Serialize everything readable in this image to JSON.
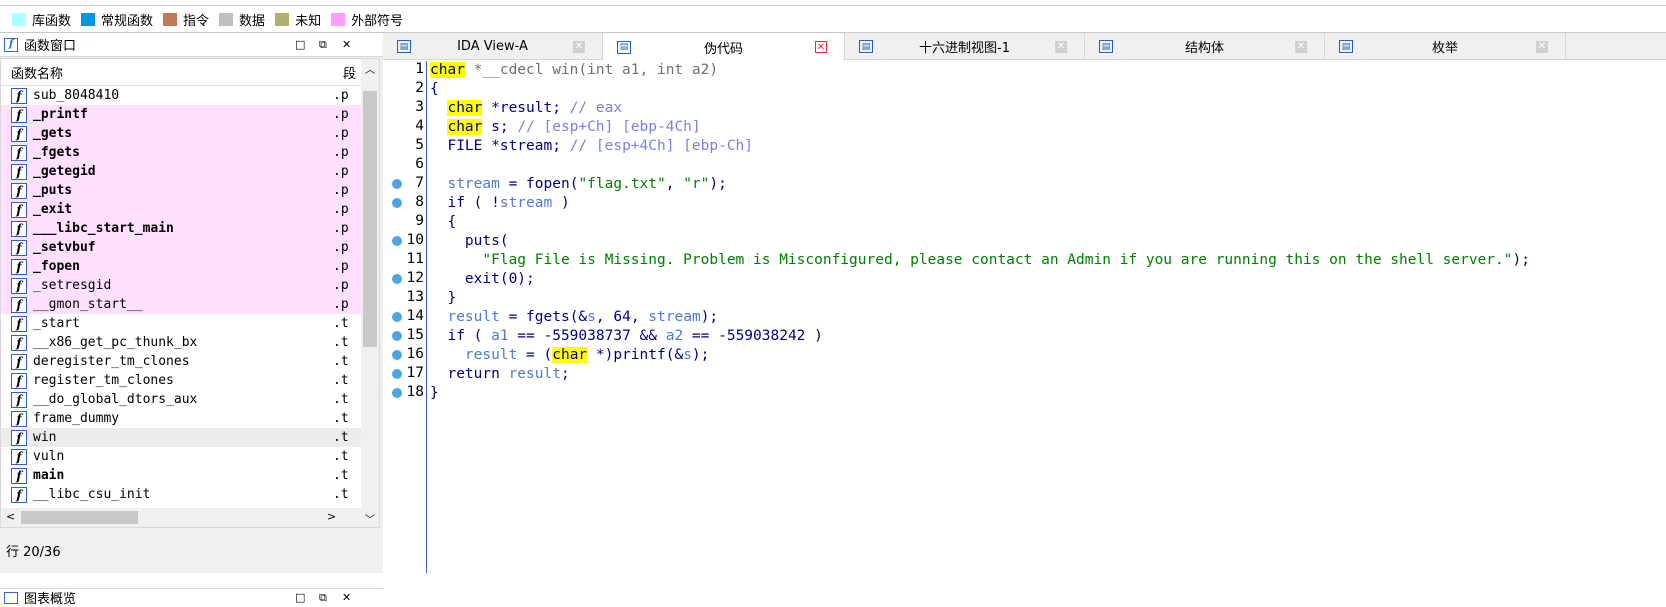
{
  "legend": [
    {
      "label": "库函数",
      "color": "#aaffff"
    },
    {
      "label": "常规函数",
      "color": "#0096e0"
    },
    {
      "label": "指令",
      "color": "#c07a5a"
    },
    {
      "label": "数据",
      "color": "#c0c0c0"
    },
    {
      "label": "未知",
      "color": "#b0b070"
    },
    {
      "label": "外部符号",
      "color": "#ff9cff"
    }
  ],
  "functions_window": {
    "title": "函数窗口",
    "col_name": "函数名称",
    "col_segment": "段",
    "rows": [
      {
        "name": "sub_8048410",
        "seg": ".p",
        "style": "normal"
      },
      {
        "name": "_printf",
        "seg": ".p",
        "style": "ext-bold"
      },
      {
        "name": "_gets",
        "seg": ".p",
        "style": "ext-bold"
      },
      {
        "name": "_fgets",
        "seg": ".p",
        "style": "ext-bold"
      },
      {
        "name": "_getegid",
        "seg": ".p",
        "style": "ext-bold"
      },
      {
        "name": "_puts",
        "seg": ".p",
        "style": "ext-bold"
      },
      {
        "name": "_exit",
        "seg": ".p",
        "style": "ext-bold"
      },
      {
        "name": "___libc_start_main",
        "seg": ".p",
        "style": "ext-bold"
      },
      {
        "name": "_setvbuf",
        "seg": ".p",
        "style": "ext-bold"
      },
      {
        "name": "_fopen",
        "seg": ".p",
        "style": "ext-bold"
      },
      {
        "name": "_setresgid",
        "seg": ".p",
        "style": "ext"
      },
      {
        "name": "__gmon_start__",
        "seg": ".p",
        "style": "ext"
      },
      {
        "name": "_start",
        "seg": ".t",
        "style": "normal"
      },
      {
        "name": "__x86_get_pc_thunk_bx",
        "seg": ".t",
        "style": "normal"
      },
      {
        "name": "deregister_tm_clones",
        "seg": ".t",
        "style": "normal"
      },
      {
        "name": "register_tm_clones",
        "seg": ".t",
        "style": "normal"
      },
      {
        "name": "__do_global_dtors_aux",
        "seg": ".t",
        "style": "normal"
      },
      {
        "name": "frame_dummy",
        "seg": ".t",
        "style": "normal"
      },
      {
        "name": "win",
        "seg": ".t",
        "style": "selected"
      },
      {
        "name": "vuln",
        "seg": ".t",
        "style": "normal"
      },
      {
        "name": "main",
        "seg": ".t",
        "style": "bold"
      },
      {
        "name": "__libc_csu_init",
        "seg": ".t",
        "style": "normal"
      }
    ],
    "status": "行 20/36"
  },
  "overview_title": "图表概览",
  "tabs": [
    {
      "label": "IDA View-A",
      "icon": "ida-view-icon",
      "active": false
    },
    {
      "label": "伪代码",
      "icon": "pseudocode-icon",
      "active": true
    },
    {
      "label": "十六进制视图-1",
      "icon": "hex-view-icon",
      "active": false
    },
    {
      "label": "结构体",
      "icon": "structures-icon",
      "active": false
    },
    {
      "label": "枚举",
      "icon": "enums-icon",
      "active": false
    }
  ],
  "code": {
    "line_numbers": [
      "1",
      "2",
      "3",
      "4",
      "5",
      "6",
      "7",
      "8",
      "9",
      "10",
      "11",
      "12",
      "13",
      "14",
      "15",
      "16",
      "17",
      "18"
    ],
    "breakpoint_lines": [
      7,
      8,
      10,
      12,
      14,
      15,
      16,
      17,
      18
    ],
    "lines": [
      [
        [
          "kw",
          "char"
        ],
        [
          "gray",
          " *__cdecl win(int a1, int a2)"
        ]
      ],
      [
        [
          "blue",
          "{"
        ]
      ],
      [
        [
          "blue",
          "  "
        ],
        [
          "kw",
          "char"
        ],
        [
          "blue",
          " *result; "
        ],
        [
          "cm",
          "// eax"
        ]
      ],
      [
        [
          "blue",
          "  "
        ],
        [
          "kw",
          "char"
        ],
        [
          "blue",
          " s; "
        ],
        [
          "cm",
          "// [esp+Ch] [ebp-4Ch]"
        ]
      ],
      [
        [
          "blue",
          "  FILE *stream; "
        ],
        [
          "cm",
          "// [esp+4Ch] [ebp-Ch]"
        ]
      ],
      [
        [
          "blue",
          ""
        ]
      ],
      [
        [
          "blue",
          "  "
        ],
        [
          "var",
          "stream"
        ],
        [
          "blue",
          " = fopen("
        ],
        [
          "str",
          "\"flag.txt\""
        ],
        [
          "blue",
          ", "
        ],
        [
          "str",
          "\"r\""
        ],
        [
          "blue",
          ");"
        ]
      ],
      [
        [
          "blue",
          "  if ( !"
        ],
        [
          "var",
          "stream"
        ],
        [
          "blue",
          " )"
        ]
      ],
      [
        [
          "blue",
          "  {"
        ]
      ],
      [
        [
          "blue",
          "    puts("
        ]
      ],
      [
        [
          "blue",
          "      "
        ],
        [
          "str",
          "\"Flag File is Missing. Problem is Misconfigured, please contact an Admin if you are running this on the shell server.\""
        ],
        [
          "blue",
          ");"
        ]
      ],
      [
        [
          "blue",
          "    exit(0);"
        ]
      ],
      [
        [
          "blue",
          "  }"
        ]
      ],
      [
        [
          "blue",
          "  "
        ],
        [
          "var",
          "result"
        ],
        [
          "blue",
          " = fgets(&"
        ],
        [
          "var",
          "s"
        ],
        [
          "blue",
          ", 64, "
        ],
        [
          "var",
          "stream"
        ],
        [
          "blue",
          ");"
        ]
      ],
      [
        [
          "blue",
          "  if ( "
        ],
        [
          "var",
          "a1"
        ],
        [
          "blue",
          " == -559038737 && "
        ],
        [
          "var",
          "a2"
        ],
        [
          "blue",
          " == -559038242 )"
        ]
      ],
      [
        [
          "blue",
          "    "
        ],
        [
          "var",
          "result"
        ],
        [
          "blue",
          " = ("
        ],
        [
          "kw",
          "char"
        ],
        [
          "blue",
          " *)printf(&"
        ],
        [
          "var",
          "s"
        ],
        [
          "blue",
          ");"
        ]
      ],
      [
        [
          "blue",
          "  return "
        ],
        [
          "var",
          "result"
        ],
        [
          "blue",
          ";"
        ]
      ],
      [
        [
          "blue",
          "}"
        ]
      ]
    ]
  }
}
